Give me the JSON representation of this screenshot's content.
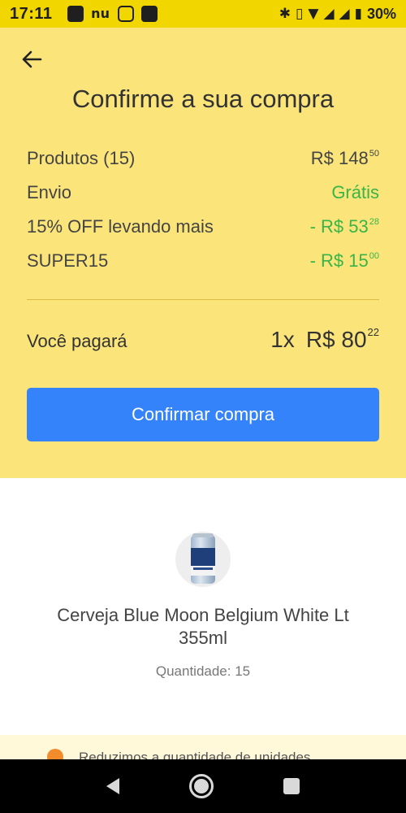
{
  "status_bar": {
    "time": "17:11",
    "battery": "30%",
    "left_icons": [
      "message-icon",
      "nu-icon",
      "app-icon",
      "square-icon"
    ],
    "right_icons": [
      "bluetooth-icon",
      "vibrate-icon",
      "wifi-icon",
      "signal-icon",
      "signal-icon",
      "battery-icon"
    ]
  },
  "header": {
    "title": "Confirme a sua compra",
    "back_icon": "arrow-left-icon"
  },
  "summary": {
    "rows": [
      {
        "label": "Produtos (15)",
        "value_main": "R$ 148",
        "value_cents": "50",
        "color": "#444444"
      },
      {
        "label": "Envio",
        "value_main": "Grátis",
        "value_cents": "",
        "color": "#38b449"
      },
      {
        "label": "15% OFF levando mais",
        "value_main": "- R$ 53",
        "value_cents": "28",
        "color": "#38b449"
      },
      {
        "label": "SUPER15",
        "value_main": "- R$ 15",
        "value_cents": "00",
        "color": "#38b449"
      }
    ]
  },
  "total": {
    "label": "Você pagará",
    "installments": "1x",
    "amount_main": "R$ 80",
    "amount_cents": "22"
  },
  "confirm_button": {
    "label": "Confirmar compra",
    "color": "#3483fa"
  },
  "product": {
    "name": "Cerveja Blue Moon Belgium White Lt 355ml",
    "quantity": "Quantidade: 15",
    "image_icon": "beer-can-icon"
  },
  "notice": {
    "text": "Reduzimos a quantidade de unidades",
    "icon": "warning-icon"
  },
  "colors": {
    "status_bar": "#f2d600",
    "header_bg": "#fbe57a",
    "green": "#38b449",
    "button_blue": "#3483fa"
  }
}
